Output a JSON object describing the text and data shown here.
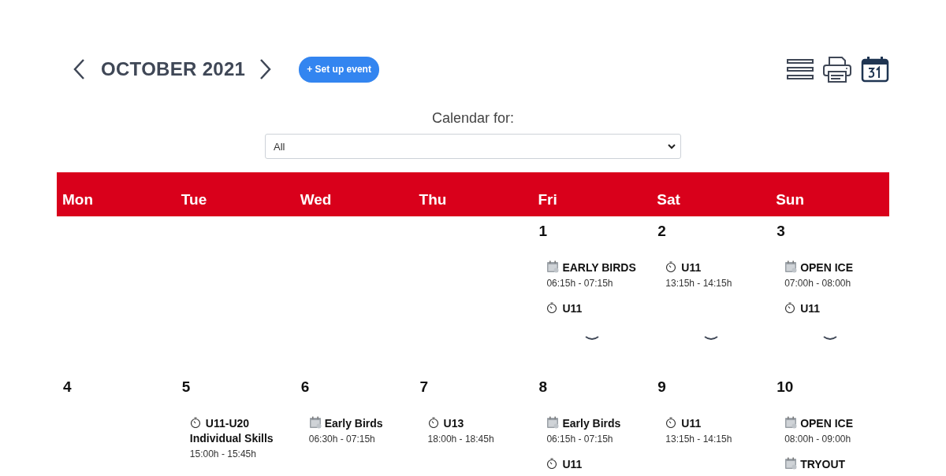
{
  "header": {
    "month": "OCTOBER 2021",
    "add_button": "+ Set up event"
  },
  "filter": {
    "label": "Calendar for:",
    "value": "All"
  },
  "weekdays": [
    "Mon",
    "Tue",
    "Wed",
    "Thu",
    "Fri",
    "Sat",
    "Sun"
  ],
  "weeks": [
    {
      "collapsed": true,
      "days": [
        {
          "more": false
        },
        {
          "more": false
        },
        {
          "more": false
        },
        {
          "more": false
        },
        {
          "number": "1",
          "more": true,
          "events": [
            {
              "kind": "booking",
              "title": "EARLY BIRDS",
              "time": "06:15h - 07:15h"
            },
            {
              "kind": "practice",
              "title": "U11"
            }
          ]
        },
        {
          "number": "2",
          "more": true,
          "events": [
            {
              "kind": "practice",
              "title": "U11",
              "time": "13:15h - 14:15h"
            }
          ]
        },
        {
          "number": "3",
          "more": true,
          "events": [
            {
              "kind": "booking",
              "title": "OPEN ICE",
              "time": "07:00h - 08:00h"
            },
            {
              "kind": "practice",
              "title": "U11"
            }
          ]
        }
      ]
    },
    {
      "collapsed": false,
      "days": [
        {
          "number": "4",
          "more": false
        },
        {
          "number": "5",
          "more": false,
          "events": [
            {
              "kind": "practice",
              "title": "U11-U20 Individual Skills",
              "time": "15:00h - 15:45h"
            }
          ]
        },
        {
          "number": "6",
          "more": false,
          "events": [
            {
              "kind": "booking",
              "title": "Early Birds",
              "time": "06:30h - 07:15h"
            }
          ]
        },
        {
          "number": "7",
          "more": false,
          "events": [
            {
              "kind": "practice",
              "title": "U13",
              "time": "18:00h - 18:45h"
            }
          ]
        },
        {
          "number": "8",
          "more": false,
          "events": [
            {
              "kind": "booking",
              "title": "Early Birds",
              "time": "06:15h - 07:15h"
            },
            {
              "kind": "practice",
              "title": "U11"
            }
          ]
        },
        {
          "number": "9",
          "more": false,
          "events": [
            {
              "kind": "practice",
              "title": "U11",
              "time": "13:15h - 14:15h"
            }
          ]
        },
        {
          "number": "10",
          "more": false,
          "events": [
            {
              "kind": "booking",
              "title": "OPEN ICE",
              "time": "08:00h - 09:00h"
            },
            {
              "kind": "booking",
              "title": "TRYOUT"
            }
          ]
        }
      ]
    }
  ]
}
